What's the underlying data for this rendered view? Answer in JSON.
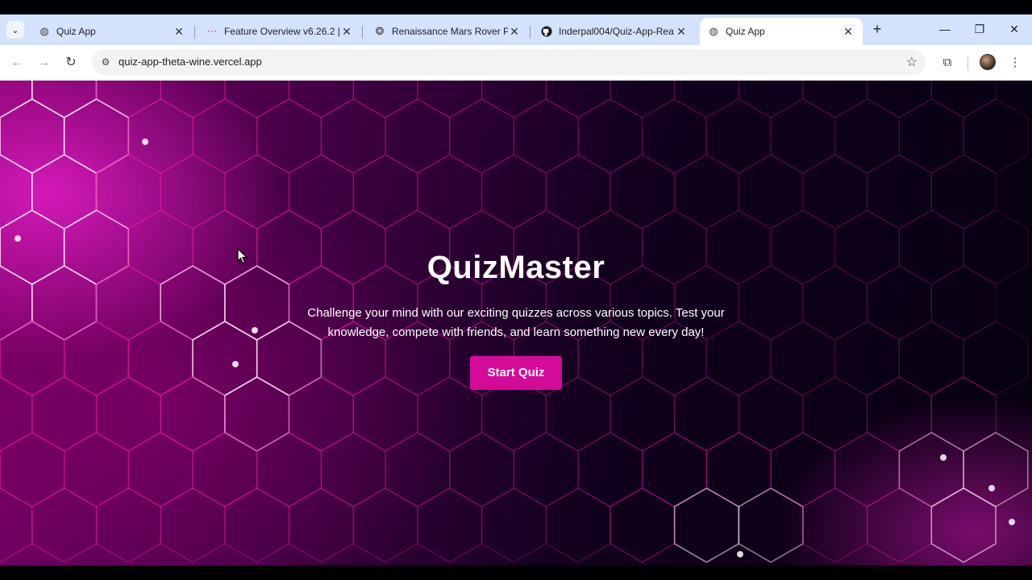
{
  "browser": {
    "tabs": [
      {
        "title": "Quiz App",
        "favicon": "globe-icon",
        "active": false
      },
      {
        "title": "Feature Overview v6.26.2 | R",
        "favicon": "react-router-icon",
        "active": false
      },
      {
        "title": "Renaissance Mars Rover Pa",
        "favicon": "chatgpt-icon",
        "active": false
      },
      {
        "title": "Inderpal004/Quiz-App-Rea",
        "favicon": "github-icon",
        "active": false
      },
      {
        "title": "Quiz App",
        "favicon": "globe-icon",
        "active": true
      }
    ],
    "url": "quiz-app-theta-wine.vercel.app"
  },
  "hero": {
    "title": "QuizMaster",
    "description": "Challenge your mind with our exciting quizzes across various topics. Test your knowledge, compete with friends, and learn something new every day!",
    "button_label": "Start Quiz"
  },
  "colors": {
    "accent": "#d40a99",
    "chrome_tabstrip": "#d3e3fd"
  }
}
